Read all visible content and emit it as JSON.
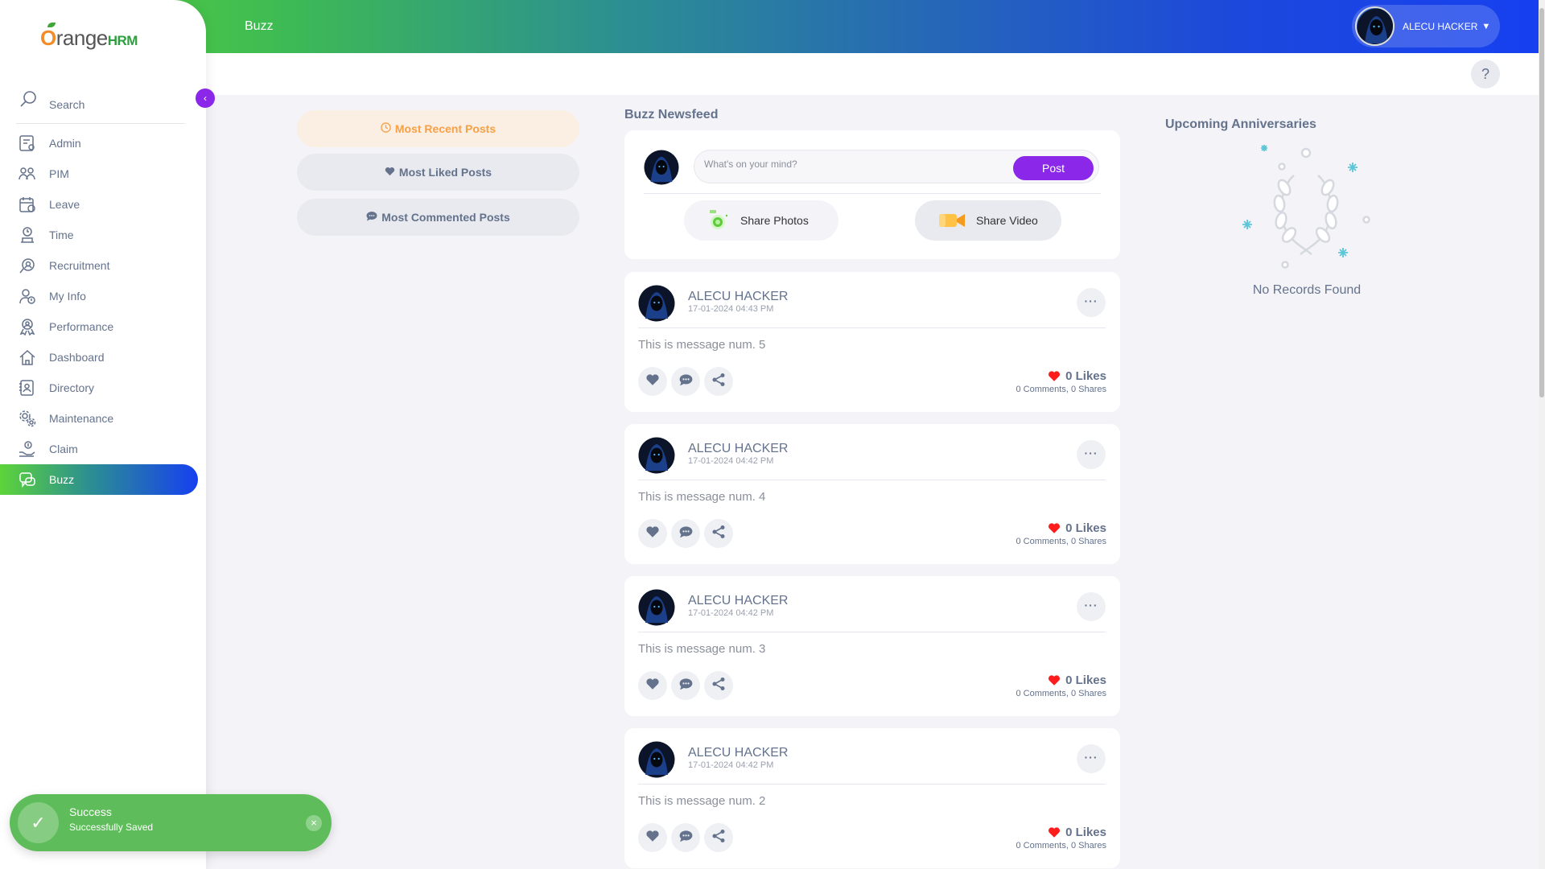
{
  "app": {
    "logo_text": "OrangeHRM",
    "colors": {
      "accent_purple": "#8a27e8",
      "orange": "#f28c28",
      "green": "#5dd43a",
      "blue": "#1640f0",
      "toast_green": "#5ebd5a",
      "heart_red": "#ff1c1c"
    }
  },
  "topbar": {
    "title": "Buzz",
    "user_name": "ALECU HACKER",
    "help_label": "?"
  },
  "sidebar": {
    "search_label": "Search",
    "items": [
      {
        "label": "Admin",
        "icon": "admin-icon"
      },
      {
        "label": "PIM",
        "icon": "pim-icon"
      },
      {
        "label": "Leave",
        "icon": "leave-icon"
      },
      {
        "label": "Time",
        "icon": "time-icon"
      },
      {
        "label": "Recruitment",
        "icon": "recruitment-icon"
      },
      {
        "label": "My Info",
        "icon": "my-info-icon"
      },
      {
        "label": "Performance",
        "icon": "performance-icon"
      },
      {
        "label": "Dashboard",
        "icon": "dashboard-icon"
      },
      {
        "label": "Directory",
        "icon": "directory-icon"
      },
      {
        "label": "Maintenance",
        "icon": "maintenance-icon"
      },
      {
        "label": "Claim",
        "icon": "claim-icon"
      },
      {
        "label": "Buzz",
        "icon": "buzz-icon",
        "active": true
      }
    ]
  },
  "filters": {
    "recent": "Most Recent Posts",
    "liked": "Most Liked Posts",
    "commented": "Most Commented Posts"
  },
  "newsfeed": {
    "title": "Buzz Newsfeed",
    "compose_placeholder": "What's on your mind?",
    "post_label": "Post",
    "share_photos": "Share Photos",
    "share_video": "Share Video",
    "posts": [
      {
        "author": "ALECU HACKER",
        "date": "17-01-2024 04:43 PM",
        "message": "This is message num. 5",
        "likes": "0 Likes",
        "comments": "0 Comments",
        "shares": "0 Shares"
      },
      {
        "author": "ALECU HACKER",
        "date": "17-01-2024 04:42 PM",
        "message": "This is message num. 4",
        "likes": "0 Likes",
        "comments": "0 Comments",
        "shares": "0 Shares"
      },
      {
        "author": "ALECU HACKER",
        "date": "17-01-2024 04:42 PM",
        "message": "This is message num. 3",
        "likes": "0 Likes",
        "comments": "0 Comments",
        "shares": "0 Shares"
      },
      {
        "author": "ALECU HACKER",
        "date": "17-01-2024 04:42 PM",
        "message": "This is message num. 2",
        "likes": "0 Likes",
        "comments": "0 Comments",
        "shares": "0 Shares"
      }
    ]
  },
  "anniversaries": {
    "title": "Upcoming Anniversaries",
    "empty": "No Records Found"
  },
  "toast": {
    "title": "Success",
    "message": "Successfully Saved",
    "close": "×"
  }
}
